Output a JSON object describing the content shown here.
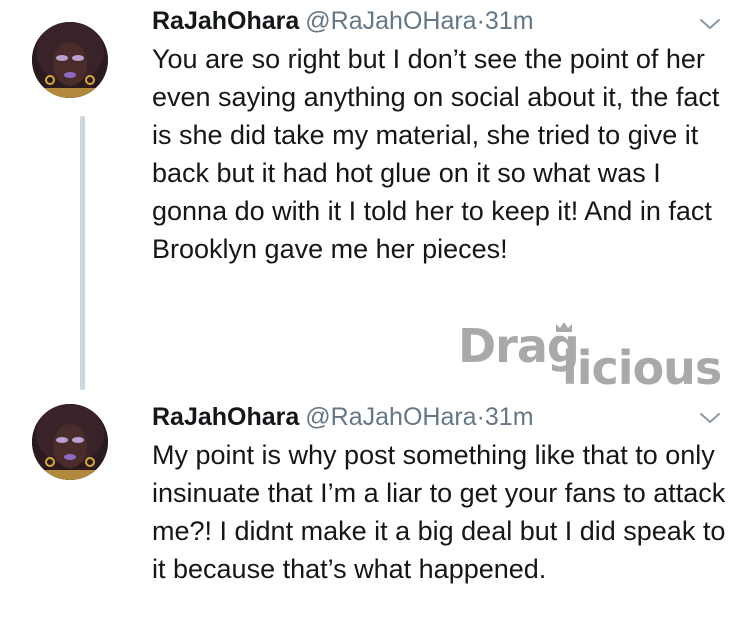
{
  "tweets": [
    {
      "name": "RaJahOhara",
      "handle": "@RaJahOHara",
      "separator": "·",
      "time": "31m",
      "text": "You are so right but I don’t see the point of her even saying anything on social about it, the fact is she did take my material, she tried to give it back but it had hot glue on it so what was I gonna do with it I told her to keep it! And in fact Brooklyn gave me her pieces!"
    },
    {
      "name": "RaJahOhara",
      "handle": "@RaJahOHara",
      "separator": "·",
      "time": "31m",
      "text": "My point is why post something like that to only insinuate that I’m a liar to get your fans to attack me?!  I didnt make it a big deal but I did speak to it because that’s what happened."
    }
  ],
  "watermark": {
    "prefix": "Drag",
    "suffix": "licious"
  },
  "colors": {
    "text": "#14171a",
    "secondary": "#657786",
    "thread_line": "#ccd6dd",
    "watermark": "#a9a9a9"
  },
  "icons": {
    "menu": "chevron-down-icon",
    "watermark_crown": "crown-icon"
  }
}
